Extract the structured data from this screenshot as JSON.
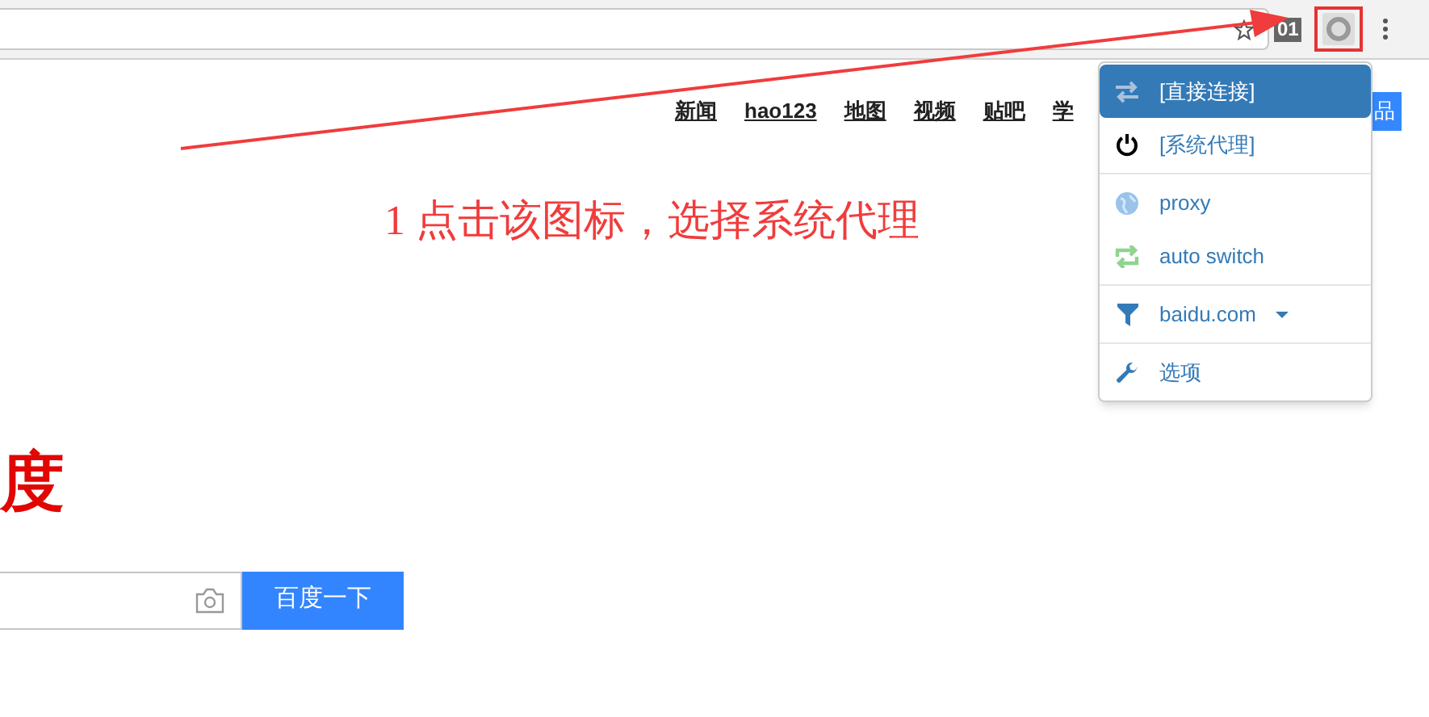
{
  "toolbar": {
    "extension_badge": "01"
  },
  "nav_links": [
    "新闻",
    "hao123",
    "地图",
    "视频",
    "贴吧",
    "学"
  ],
  "products_button": "品",
  "annotation": "1 点击该图标，选择系统代理",
  "logo": "度",
  "search": {
    "button": "百度一下"
  },
  "menu": [
    {
      "kind": "direct",
      "label": "[直接连接]",
      "selected": true
    },
    {
      "kind": "system",
      "label": "[系统代理]",
      "selected": false
    },
    {
      "kind": "divider"
    },
    {
      "kind": "proxy",
      "label": "proxy",
      "selected": false
    },
    {
      "kind": "auto",
      "label": "auto switch",
      "selected": false
    },
    {
      "kind": "divider"
    },
    {
      "kind": "domain",
      "label": "baidu.com",
      "selected": false
    },
    {
      "kind": "divider"
    },
    {
      "kind": "options",
      "label": "选项",
      "selected": false
    }
  ]
}
